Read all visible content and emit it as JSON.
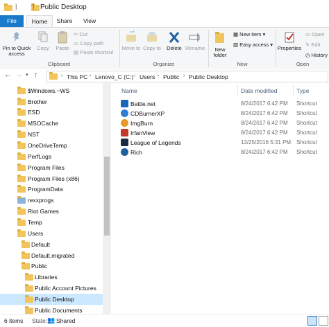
{
  "window": {
    "title": "Public Desktop"
  },
  "tabs": {
    "file": "File",
    "home": "Home",
    "share": "Share",
    "view": "View"
  },
  "ribbon": {
    "pin": "Pin to Quick access",
    "copy": "Copy",
    "paste": "Paste",
    "cut": "Cut",
    "copy_path": "Copy path",
    "paste_shortcut": "Paste shortcut",
    "move_to": "Move to",
    "copy_to": "Copy to",
    "delete": "Delete",
    "rename": "Rename",
    "new_folder": "New folder",
    "new_item": "New item",
    "easy_access": "Easy access",
    "properties": "Properties",
    "open": "Open",
    "edit": "Edit",
    "history": "History",
    "groups": {
      "clipboard": "Clipboard",
      "organize": "Organize",
      "new": "New",
      "open": "Open"
    }
  },
  "address": {
    "crumbs": [
      "This PC",
      "Lenovo_C (C:)",
      "Users",
      "Public",
      "Public Desktop"
    ]
  },
  "nav": {
    "items": [
      "$Windows.~WS",
      "Brother",
      "ESD",
      "MSOCache",
      "NST",
      "OneDriveTemp",
      "PerfLogs",
      "Program Files",
      "Program Files (x86)",
      "ProgramData",
      "rexxprogs",
      "Riot Games",
      "Temp",
      "Users",
      "Default",
      "Default.migrated",
      "Public",
      "Libraries",
      "Public Account Pictures",
      "Public Desktop",
      "Public Documents"
    ]
  },
  "columns": {
    "name": "Name",
    "date": "Date modified",
    "type": "Type"
  },
  "files": [
    {
      "name": "Battle.net",
      "date": "8/24/2017 6:42 PM",
      "type": "Shortcut",
      "color": "#1a66b8"
    },
    {
      "name": "CDBurnerXP",
      "date": "8/24/2017 6:42 PM",
      "type": "Shortcut",
      "color": "#2d7dd2"
    },
    {
      "name": "ImgBurn",
      "date": "8/24/2017 6:42 PM",
      "type": "Shortcut",
      "color": "#e39a2b"
    },
    {
      "name": "IrfanView",
      "date": "8/24/2017 6:42 PM",
      "type": "Shortcut",
      "color": "#c0392b"
    },
    {
      "name": "League of Legends",
      "date": "12/25/2016 5:31 PM",
      "type": "Shortcut",
      "color": "#1d2a44"
    },
    {
      "name": "Rich",
      "date": "8/24/2017 6:42 PM",
      "type": "Shortcut",
      "color": "#1e5fa0"
    }
  ],
  "status": {
    "count": "6 items",
    "state": "State:",
    "shared": "Shared"
  }
}
